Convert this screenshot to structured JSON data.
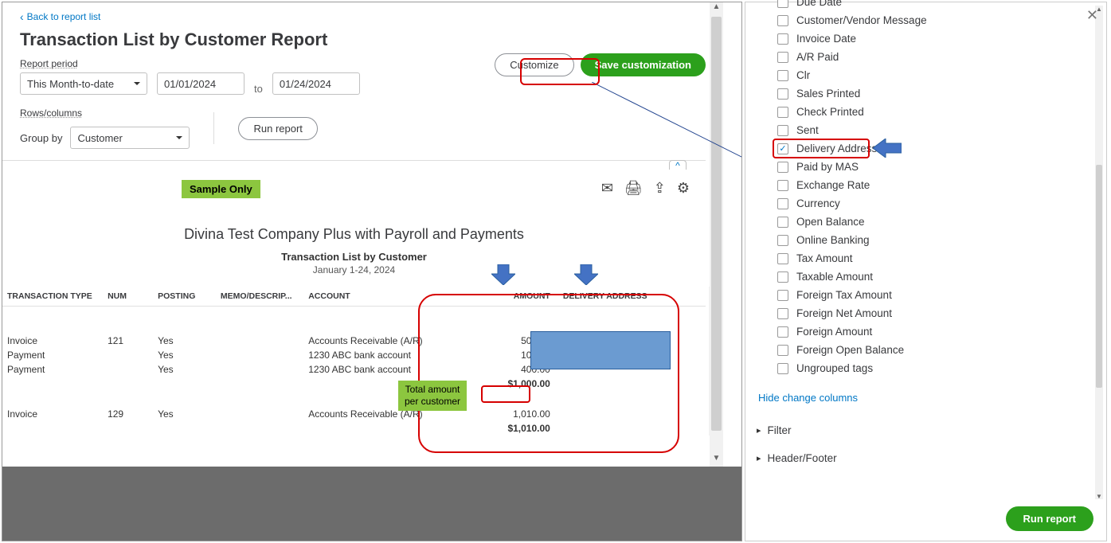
{
  "back_link": "Back to report list",
  "title": "Transaction List by Customer Report",
  "period_label": "Report period",
  "period_select": "This Month-to-date",
  "date_from": "01/01/2024",
  "date_to": "01/24/2024",
  "to_label": "to",
  "customize_label": "Customize",
  "save_customization_label": "Save customization",
  "rows_columns_label": "Rows/columns",
  "group_by_label": "Group by",
  "group_by_value": "Customer",
  "run_report_label": "Run report",
  "sample_badge": "Sample Only",
  "company_name": "Divina Test Company Plus with Payroll and Payments",
  "list_title": "Transaction List by Customer",
  "date_range_text": "January 1-24, 2024",
  "columns": {
    "transaction_type": "TRANSACTION TYPE",
    "num": "NUM",
    "posting": "POSTING",
    "memo": "MEMO/DESCRIP...",
    "account": "ACCOUNT",
    "amount": "AMOUNT",
    "delivery": "DELIVERY ADDRESS"
  },
  "rows": [
    {
      "type": "Invoice",
      "num": "121",
      "posting": "Yes",
      "memo": "",
      "account": "Accounts Receivable (A/R)",
      "amount": "500.00"
    },
    {
      "type": "Payment",
      "num": "",
      "posting": "Yes",
      "memo": "",
      "account": "1230 ABC bank account",
      "amount": "100.00"
    },
    {
      "type": "Payment",
      "num": "",
      "posting": "Yes",
      "memo": "",
      "account": "1230 ABC bank account",
      "amount": "400.00"
    }
  ],
  "subtotal": "$1,000.00",
  "rows2": [
    {
      "type": "Invoice",
      "num": "129",
      "posting": "Yes",
      "memo": "",
      "account": "Accounts Receivable (A/R)",
      "amount": "1,010.00"
    }
  ],
  "subtotal2": "$1,010.00",
  "callout_total": "Total amount\nper customer",
  "panel": {
    "items": [
      {
        "label": "Due Date",
        "checked": false,
        "cutoff": true
      },
      {
        "label": "Customer/Vendor Message",
        "checked": false
      },
      {
        "label": "Invoice Date",
        "checked": false
      },
      {
        "label": "A/R Paid",
        "checked": false
      },
      {
        "label": "Clr",
        "checked": false
      },
      {
        "label": "Sales Printed",
        "checked": false
      },
      {
        "label": "Check Printed",
        "checked": false
      },
      {
        "label": "Sent",
        "checked": false
      },
      {
        "label": "Delivery Address",
        "checked": true,
        "highlight": true
      },
      {
        "label": "Paid by MAS",
        "checked": false
      },
      {
        "label": "Exchange Rate",
        "checked": false
      },
      {
        "label": "Currency",
        "checked": false
      },
      {
        "label": "Open Balance",
        "checked": false
      },
      {
        "label": "Online Banking",
        "checked": false
      },
      {
        "label": "Tax Amount",
        "checked": false
      },
      {
        "label": "Taxable Amount",
        "checked": false
      },
      {
        "label": "Foreign Tax Amount",
        "checked": false
      },
      {
        "label": "Foreign Net Amount",
        "checked": false
      },
      {
        "label": "Foreign Amount",
        "checked": false
      },
      {
        "label": "Foreign Open Balance",
        "checked": false
      },
      {
        "label": "Ungrouped tags",
        "checked": false
      }
    ],
    "hide_link": "Hide change columns",
    "filter_label": "Filter",
    "header_footer_label": "Header/Footer",
    "run_report": "Run report"
  }
}
